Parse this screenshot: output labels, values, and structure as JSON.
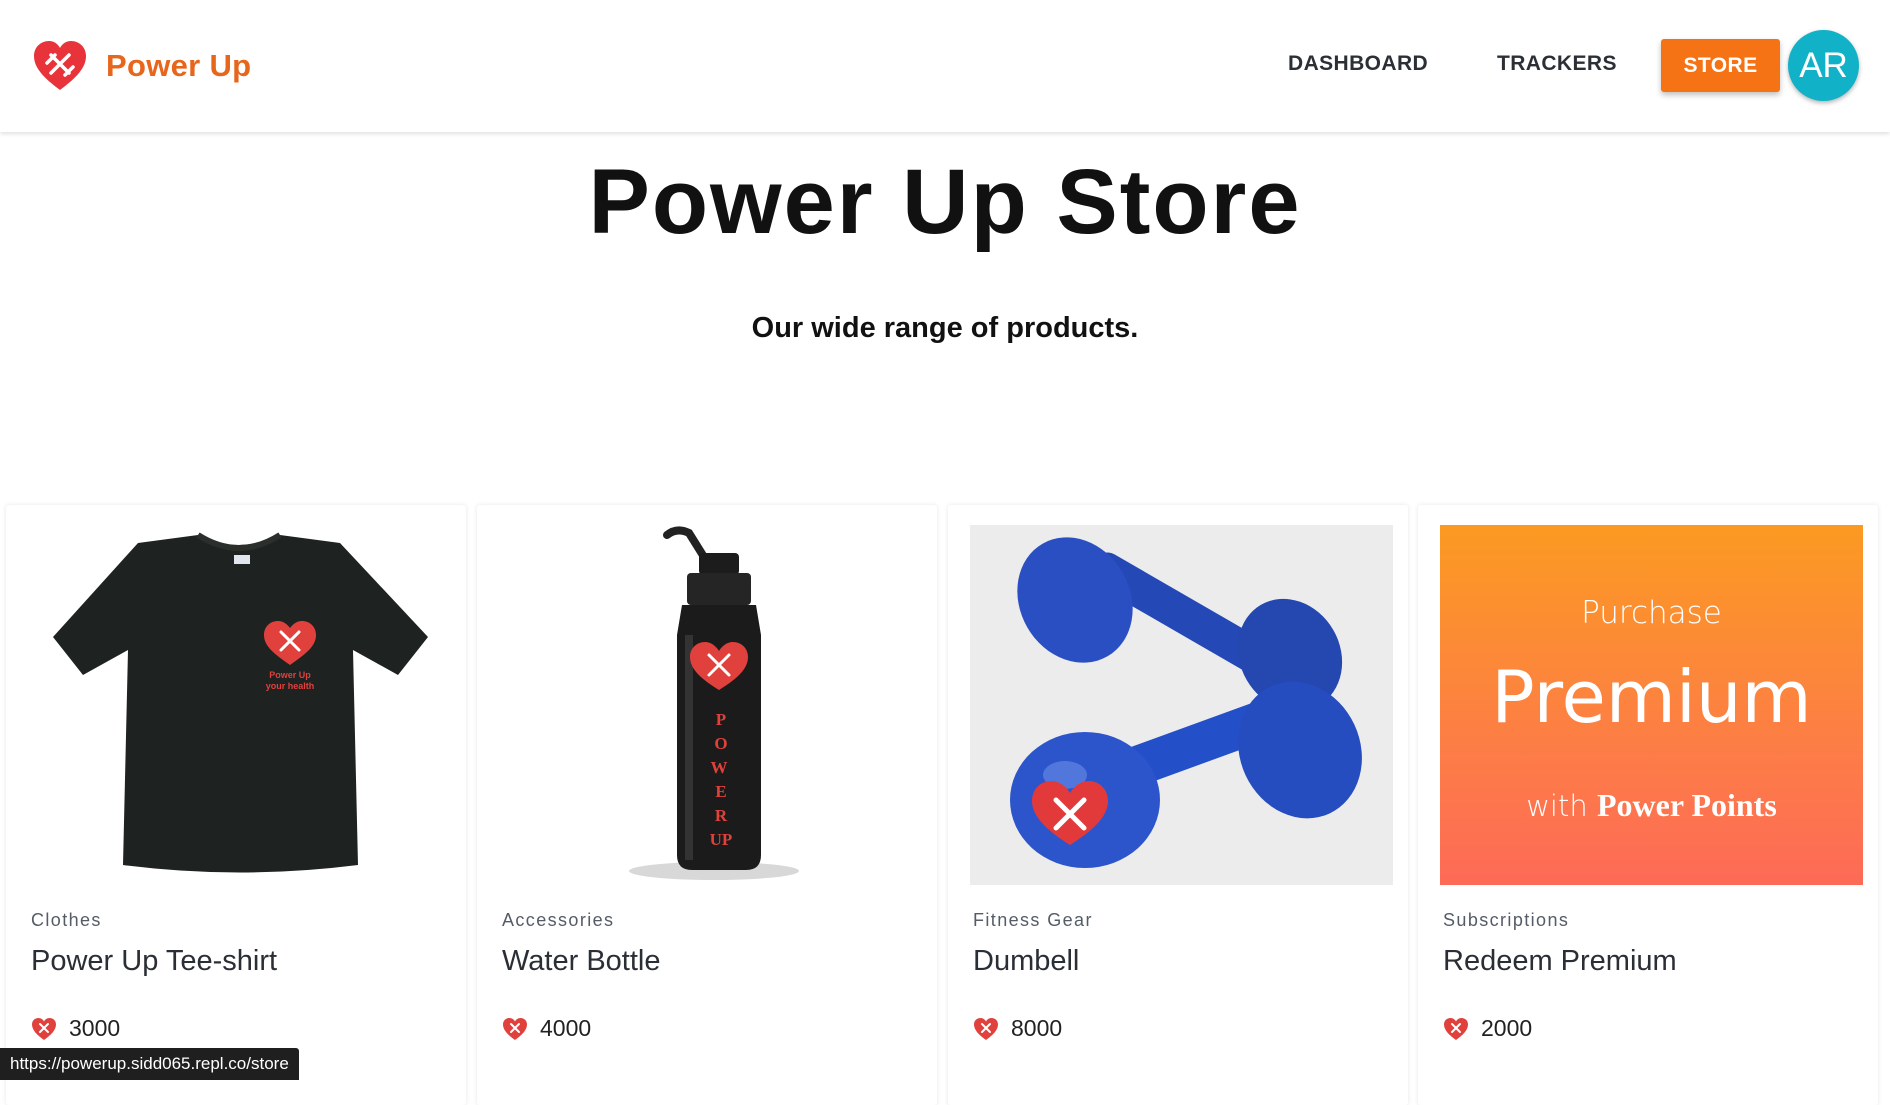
{
  "brand": {
    "name": "Power Up",
    "logo_icon": "heart-logo-icon",
    "accent": "#e8661c"
  },
  "nav": {
    "dashboard": "DASHBOARD",
    "trackers": "TRACKERS",
    "store": "STORE",
    "store_color": "#f57315"
  },
  "user": {
    "initials": "AR",
    "avatar_color": "#11b1c7"
  },
  "page": {
    "title": "Power Up Store",
    "subtitle": "Our wide range of products."
  },
  "products": [
    {
      "category": "Clothes",
      "name": "Power Up Tee-shirt",
      "price": "3000",
      "image_text": "Power Up\nyour health",
      "image_icon": "tshirt-image"
    },
    {
      "category": "Accessories",
      "name": "Water Bottle",
      "price": "4000",
      "image_text": "POWERUP",
      "image_icon": "water-bottle-image"
    },
    {
      "category": "Fitness Gear",
      "name": "Dumbell",
      "price": "8000",
      "image_icon": "dumbbell-image"
    },
    {
      "category": "Subscriptions",
      "name": "Redeem Premium",
      "price": "2000",
      "image_icon": "premium-banner-image",
      "banner": {
        "line1": "Purchase",
        "line2": "Premium",
        "line3a": "with ",
        "line3b": "Power Points"
      }
    }
  ],
  "status_url": "https://powerup.sidd065.repl.co/store",
  "loading_progress": 0.2
}
